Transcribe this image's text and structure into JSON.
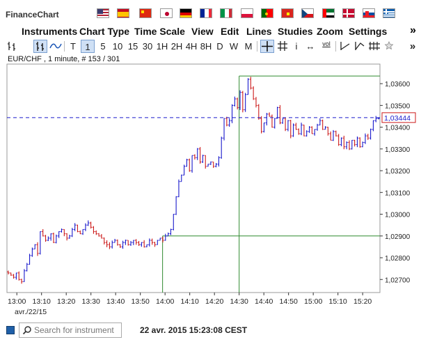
{
  "app": {
    "title": "FinanceChart"
  },
  "languages": [
    {
      "name": "us-flag-icon"
    },
    {
      "name": "es-flag-icon"
    },
    {
      "name": "cn-flag-icon"
    },
    {
      "name": "jp-flag-icon"
    },
    {
      "name": "de-flag-icon"
    },
    {
      "name": "fr-flag-icon"
    },
    {
      "name": "it-flag-icon"
    },
    {
      "name": "pl-flag-icon"
    },
    {
      "name": "pt-flag-icon"
    },
    {
      "name": "vn-flag-icon"
    },
    {
      "name": "cz-flag-icon"
    },
    {
      "name": "ae-flag-icon"
    },
    {
      "name": "dk-flag-icon"
    },
    {
      "name": "sk-flag-icon"
    },
    {
      "name": "gr-flag-icon"
    }
  ],
  "menu": {
    "items": [
      "Instruments",
      "Chart Type",
      "Time Scale",
      "View",
      "Edit",
      "Lines",
      "Studies",
      "Zoom",
      "Settings"
    ],
    "more": "»"
  },
  "toolbar": {
    "type_t": "T",
    "scale_1": "1",
    "scale_5": "5",
    "scale_10": "10",
    "scale_15": "15",
    "scale_30": "30",
    "scale_1h": "1H",
    "scale_2h": "2H",
    "scale_4h": "4H",
    "scale_8h": "8H",
    "scale_d": "D",
    "scale_w": "W",
    "scale_m": "M",
    "info": "i",
    "fit": "↔",
    "vol": "vol",
    "more": "»"
  },
  "chart_info": "EUR/CHF , 1 minute, # 153 / 301",
  "chart_data": {
    "type": "ohlc",
    "symbol": "EUR/CHF",
    "interval": "1 minute",
    "date_label": "avr./22/15",
    "x_ticks": [
      "13:00",
      "13:10",
      "13:20",
      "13:30",
      "13:40",
      "13:50",
      "14:00",
      "14:10",
      "14:20",
      "14:30",
      "14:40",
      "14:50",
      "15:00",
      "15:10",
      "15:20"
    ],
    "y_ticks": [
      "1,02700",
      "1,02800",
      "1,02900",
      "1,03000",
      "1,03100",
      "1,03200",
      "1,03300",
      "1,03400",
      "1,03500",
      "1,03600"
    ],
    "ylim": [
      1.0264,
      1.0369
    ],
    "xlim": [
      "12:56",
      "15:27"
    ],
    "current_price": 1.03444,
    "current_price_label": "1,03444",
    "up_color": "#1a1acc",
    "down_color": "#cc1a1a",
    "crosshair_h_price": 1.029,
    "crosshair_h_from": "13:59",
    "crosshair_v_time": "14:30",
    "high_marker": {
      "time": "14:30",
      "price": 1.03635
    },
    "close": [
      1.0273,
      1.0272,
      1.0271,
      1.0273,
      1.027,
      1.0269,
      1.0274,
      1.0277,
      1.0281,
      1.0284,
      1.0286,
      1.0282,
      1.0292,
      1.029,
      1.0288,
      1.0289,
      1.0291,
      1.0287,
      1.029,
      1.0292,
      1.0293,
      1.0291,
      1.0289,
      1.029,
      1.0293,
      1.0295,
      1.0292,
      1.0291,
      1.0293,
      1.0295,
      1.0296,
      1.0294,
      1.0292,
      1.0291,
      1.029,
      1.0289,
      1.0287,
      1.0286,
      1.0285,
      1.0287,
      1.0288,
      1.0286,
      1.0285,
      1.0287,
      1.0288,
      1.0286,
      1.0287,
      1.0288,
      1.0287,
      1.0286,
      1.0287,
      1.0285,
      1.0286,
      1.0288,
      1.0287,
      1.0286,
      1.0288,
      1.0289,
      1.0288,
      1.029,
      1.0291,
      1.0293,
      1.03,
      1.0308,
      1.0315,
      1.0318,
      1.0322,
      1.0325,
      1.032,
      1.0327,
      1.0326,
      1.033,
      1.0324,
      1.0327,
      1.0322,
      1.0323,
      1.0324,
      1.0322,
      1.0323,
      1.0326,
      1.0335,
      1.0344,
      1.0341,
      1.0343,
      1.035,
      1.0353,
      1.0349,
      1.0356,
      1.0348,
      1.0355,
      1.0362,
      1.0358,
      1.0353,
      1.035,
      1.0344,
      1.0338,
      1.0342,
      1.0346,
      1.0345,
      1.034,
      1.0344,
      1.0349,
      1.0342,
      1.0344,
      1.0339,
      1.0343,
      1.0336,
      1.0341,
      1.0339,
      1.0337,
      1.0341,
      1.0336,
      1.0338,
      1.034,
      1.0337,
      1.0339,
      1.0341,
      1.0343,
      1.0339,
      1.034,
      1.0337,
      1.0334,
      1.0338,
      1.0336,
      1.0332,
      1.0335,
      1.0331,
      1.0333,
      1.033,
      1.0334,
      1.0332,
      1.0335,
      1.0331,
      1.0333,
      1.0336,
      1.0335,
      1.0339,
      1.0343,
      1.0344,
      1.0344
    ]
  },
  "status": {
    "search_placeholder": "Search for instrument",
    "datetime": "22 avr. 2015 15:23:08 CEST"
  }
}
